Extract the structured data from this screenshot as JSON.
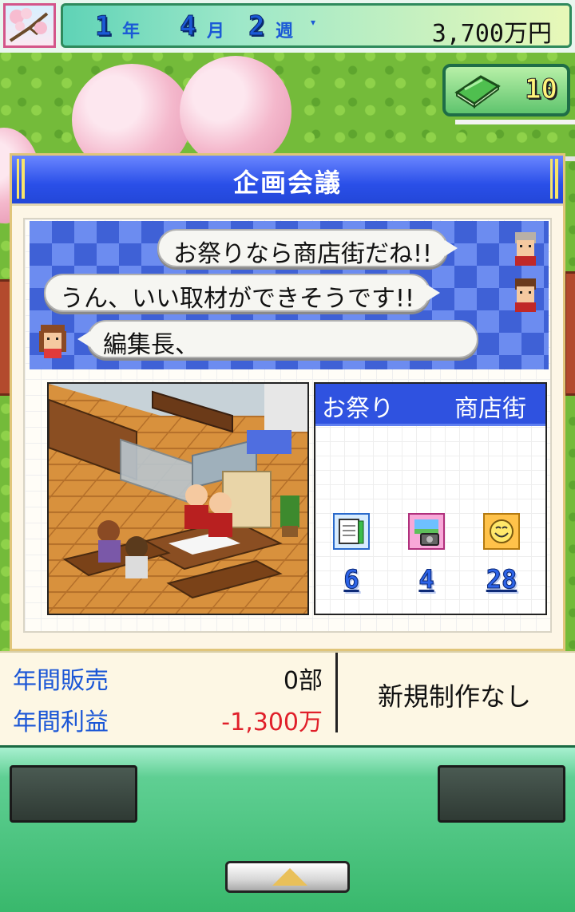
{
  "date": {
    "year": "1",
    "year_unit": "年",
    "month": "4",
    "month_unit": "月",
    "week": "2",
    "week_unit": "週",
    "money": "3,700万円"
  },
  "book_counter": {
    "count": "10",
    "icon": "green-book-icon"
  },
  "meeting": {
    "title": "企画会議",
    "dialogue": [
      {
        "text": "お祭りなら商店街だね!!",
        "speaker_side": "right"
      },
      {
        "text": "うん、いい取材ができそうです!!",
        "speaker_side": "right"
      },
      {
        "text": "編集長、",
        "speaker_side": "left"
      }
    ],
    "topics": [
      "お祭り",
      "商店街"
    ],
    "stats": [
      {
        "icon": "notebook-icon",
        "value": "6"
      },
      {
        "icon": "photo-icon",
        "value": "4"
      },
      {
        "icon": "smiley-icon",
        "value": "28"
      }
    ]
  },
  "annual": {
    "sales_label": "年間販売",
    "sales_value": "0部",
    "profit_label": "年間利益",
    "profit_value": "-1,300万",
    "status": "新規制作なし"
  },
  "colors": {
    "accent_blue": "#2f52e0",
    "profit_negative": "#e0202a",
    "label_blue": "#1c57d6"
  }
}
